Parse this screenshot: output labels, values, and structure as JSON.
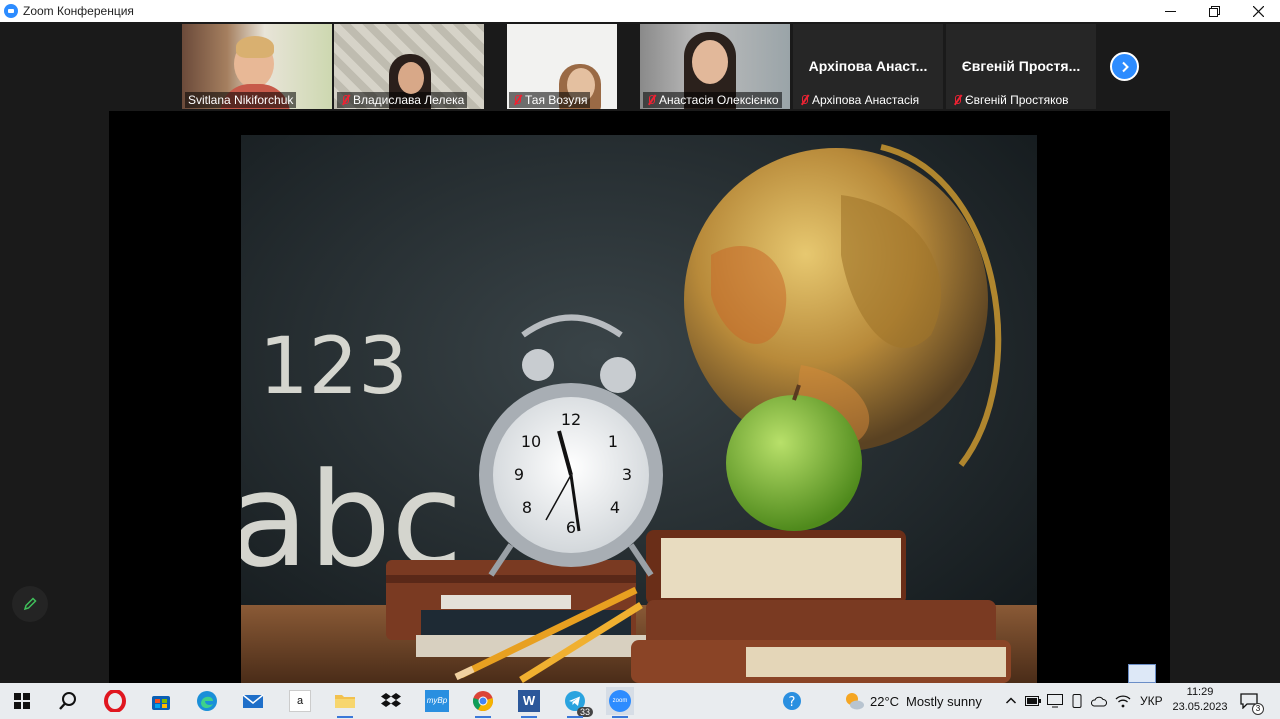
{
  "window": {
    "title": "Zoom Конференция",
    "controls": {
      "minimize": "—",
      "restore": "❐",
      "close": "✕"
    }
  },
  "gallery": {
    "participants": [
      {
        "name": "Svitlana Nikiforchuk",
        "muted": false,
        "video": true
      },
      {
        "name": "Владислава Лелека",
        "muted": true,
        "video": true,
        "active_speaker": true
      },
      {
        "name": "Тая Возуля",
        "muted": true,
        "video": true
      },
      {
        "name": "Анастасія Олексієнко",
        "muted": true,
        "video": true
      },
      {
        "name": "Архіпова Анастасія",
        "display_name": "Архіпова Анаст...",
        "muted": true,
        "video": false
      },
      {
        "name": "Євгеній Простяков",
        "display_name": "Євгеній Простя...",
        "muted": true,
        "video": false
      }
    ],
    "next_page_icon": "chevron-right-icon"
  },
  "share": {
    "slide_text": {
      "numbers": "123",
      "letters": "abc"
    },
    "annotate_icon": "pencil-icon"
  },
  "taskbar": {
    "apps": [
      {
        "name": "start",
        "icon": "windows-logo-icon"
      },
      {
        "name": "search",
        "icon": "search-icon"
      },
      {
        "name": "opera",
        "icon": "opera-icon"
      },
      {
        "name": "store",
        "icon": "store-icon"
      },
      {
        "name": "edge",
        "icon": "edge-icon"
      },
      {
        "name": "mail",
        "icon": "mail-icon"
      },
      {
        "name": "amazon",
        "icon": "amazon-icon",
        "label": "a"
      },
      {
        "name": "explorer",
        "icon": "folder-icon"
      },
      {
        "name": "dropbox",
        "icon": "dropbox-icon"
      },
      {
        "name": "mybp",
        "icon": "mybp-icon",
        "label": "myBp"
      },
      {
        "name": "chrome",
        "icon": "chrome-icon"
      },
      {
        "name": "word",
        "icon": "word-icon",
        "label": "W"
      },
      {
        "name": "telegram",
        "icon": "telegram-icon",
        "badge": "33"
      },
      {
        "name": "zoom",
        "icon": "zoom-icon",
        "label": "zoom"
      }
    ],
    "weather": {
      "temperature": "22°C",
      "condition": "Mostly sunny"
    },
    "language": "УКР",
    "time": "11:29",
    "date": "23.05.2023",
    "notifications_count": "3"
  }
}
